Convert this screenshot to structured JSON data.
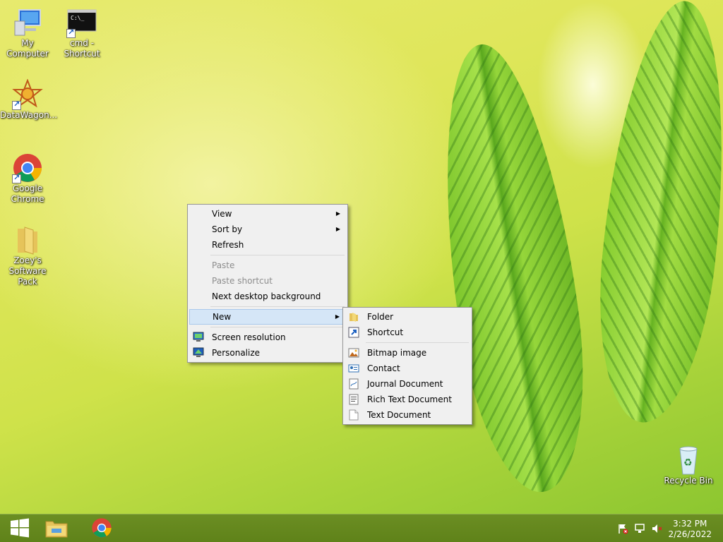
{
  "desktop": {
    "icons": [
      {
        "label": "My Computer",
        "icon": "computer-icon"
      },
      {
        "label": "cmd -\nShortcut",
        "icon": "cmd-icon"
      },
      {
        "label": "DataWagon...",
        "icon": "datawagon-icon"
      },
      {
        "label": "Google\nChrome",
        "icon": "chrome-icon"
      },
      {
        "label": "Zoey's\nSoftware Pack",
        "icon": "folder-icon"
      },
      {
        "label": "Recycle Bin",
        "icon": "recycle-bin-icon"
      }
    ]
  },
  "context_menu": {
    "items": {
      "view": "View",
      "sort_by": "Sort by",
      "refresh": "Refresh",
      "paste": "Paste",
      "paste_shortcut": "Paste shortcut",
      "next_background": "Next desktop background",
      "new": "New",
      "screen_resolution": "Screen resolution",
      "personalize": "Personalize"
    }
  },
  "new_submenu": {
    "items": {
      "folder": "Folder",
      "shortcut": "Shortcut",
      "bitmap": "Bitmap image",
      "contact": "Contact",
      "journal": "Journal Document",
      "rtf": "Rich Text Document",
      "text": "Text Document"
    }
  },
  "taskbar": {
    "start": "windows-start-icon",
    "pinned": [
      "file-explorer-icon",
      "chrome-icon"
    ],
    "tray": [
      "action-center-flag-icon",
      "network-icon",
      "volume-muted-icon"
    ],
    "time": "3:32 PM",
    "date": "2/26/2022"
  },
  "colors": {
    "menu_bg": "#f0f0f0",
    "menu_highlight": "#d5e6f7",
    "taskbar": "#6b8e23"
  }
}
